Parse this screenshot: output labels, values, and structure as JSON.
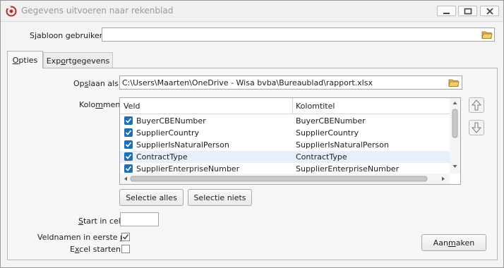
{
  "window": {
    "title": "Gegevens uitvoeren naar rekenblad",
    "controls": [
      "minimize",
      "maximize",
      "close"
    ]
  },
  "template": {
    "label_pre": "S",
    "label_ul": "j",
    "label_post": "abloon gebruiken",
    "value": ""
  },
  "tabs": [
    {
      "pre": "",
      "ul": "O",
      "post": "pties",
      "active": true
    },
    {
      "pre": "Exp",
      "ul": "o",
      "post": "rtgegevens",
      "active": false
    }
  ],
  "save_as": {
    "label_pre": "Op",
    "label_ul": "s",
    "label_post": "laan als",
    "value": "C:\\Users\\Maarten\\OneDrive - Wisa bvba\\Bureaublad\\rapport.xlsx"
  },
  "columns": {
    "label_pre": "Kolo",
    "label_ul": "m",
    "label_post": "men",
    "headers": [
      "Veld",
      "Kolomtitel"
    ],
    "rows": [
      {
        "field": "BuyerCBENumber",
        "title": "BuyerCBENumber",
        "checked": true
      },
      {
        "field": "SupplierCountry",
        "title": "SupplierCountry",
        "checked": true
      },
      {
        "field": "SupplierIsNaturalPerson",
        "title": "SupplierIsNaturalPerson",
        "checked": true
      },
      {
        "field": "ContractType",
        "title": "ContractType",
        "checked": true,
        "selected": true
      },
      {
        "field": "SupplierEnterpriseNumber",
        "title": "SupplierEnterpriseNumber",
        "checked": true
      }
    ]
  },
  "buttons": {
    "select_all": "Selectie alles",
    "select_none": "Selectie niets",
    "create_pre": "Aan",
    "create_ul": "m",
    "create_post": "aken"
  },
  "start_cell": {
    "label_pre": "",
    "label_ul": "S",
    "label_post": "tart in cel",
    "value": ""
  },
  "field_names_first_row": {
    "label_pre": "Veldnamen in eerste ",
    "label_ul": "r",
    "label_post": "ij",
    "checked": true
  },
  "excel_start": {
    "label_pre": "E",
    "label_ul": "x",
    "label_post": "cel starten",
    "checked": false
  },
  "colors": {
    "accent": "#1f6fb4",
    "selected_row": "#e7f0fa",
    "icon_red": "#c0262d",
    "folder": "#e2b44a"
  }
}
